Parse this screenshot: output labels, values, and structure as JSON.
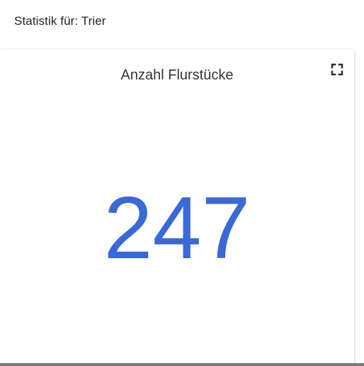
{
  "header": {
    "title": "Statistik für: Trier"
  },
  "widget": {
    "title": "Anzahl Flurstücke",
    "value": "247",
    "value_color": "#3a68d8",
    "action_icon": "fullscreen-icon"
  }
}
